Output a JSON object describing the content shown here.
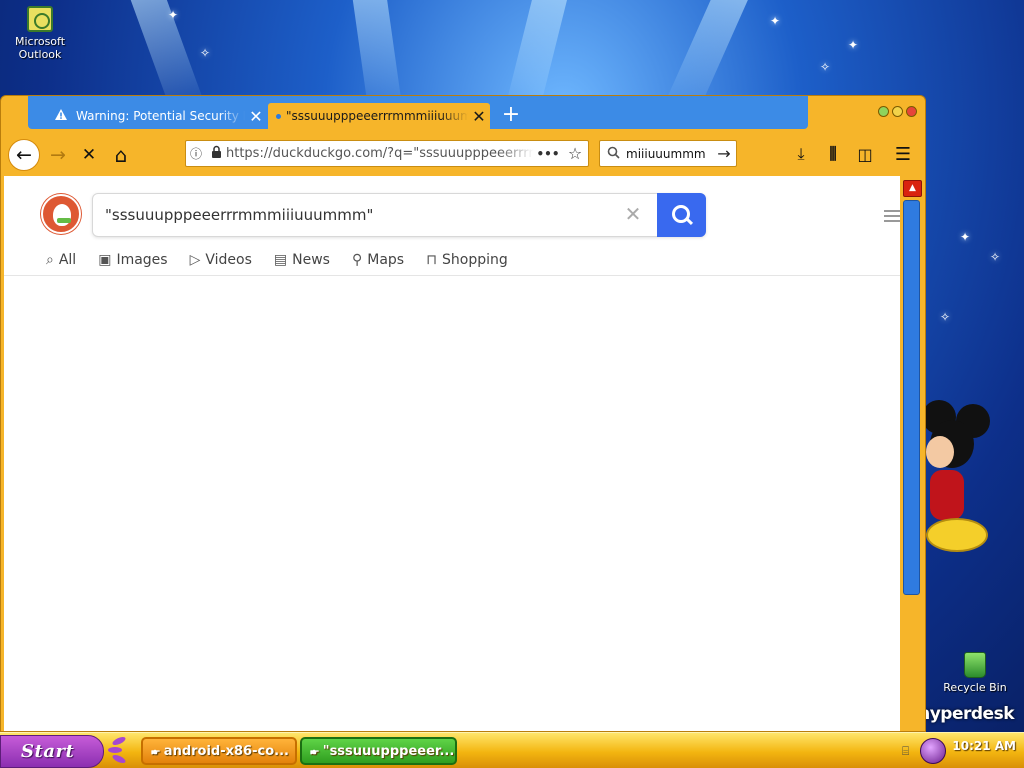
{
  "desktop": {
    "icons": [
      {
        "label_line1": "Microsoft",
        "label_line2": "Outlook"
      },
      {
        "label_line1": "Recycle Bin",
        "label_line2": ""
      }
    ],
    "brand": "hyperdesk"
  },
  "browser": {
    "tabs": [
      {
        "title": "Warning: Potential Security Risk Ahead",
        "icon": "warning-icon",
        "active": false
      },
      {
        "title": "\"sssuuupppeeerrrmmmiiiuuummm\"",
        "icon": "loading-dot-icon",
        "active": true
      }
    ],
    "nav": {
      "back_icon": "←",
      "forward_icon": "→",
      "stop_icon": "✕",
      "home_icon": "⌂"
    },
    "url": "https://duckduckgo.com/?q=\"sssuuupppeeerrrmmmiiiuuummm\"",
    "search_box_value": "miiiuuummm",
    "accent": "#f6b52a"
  },
  "page": {
    "query": "\"sssuuupppeeerrrmmmiiiuuummm\"",
    "tabs": [
      {
        "label": "All",
        "icon": "⌕"
      },
      {
        "label": "Images",
        "icon": "▣"
      },
      {
        "label": "Videos",
        "icon": "▷"
      },
      {
        "label": "News",
        "icon": "▤"
      },
      {
        "label": "Maps",
        "icon": "⚲"
      },
      {
        "label": "Shopping",
        "icon": "⊓"
      }
    ],
    "search_button_color": "#3969ef"
  },
  "taskbar": {
    "start_label": "Start",
    "tasks": [
      {
        "label": "android-x86-co...",
        "active": false
      },
      {
        "label": "\"sssuuupppeeer...",
        "active": true
      }
    ],
    "clock": "10:21 AM"
  }
}
